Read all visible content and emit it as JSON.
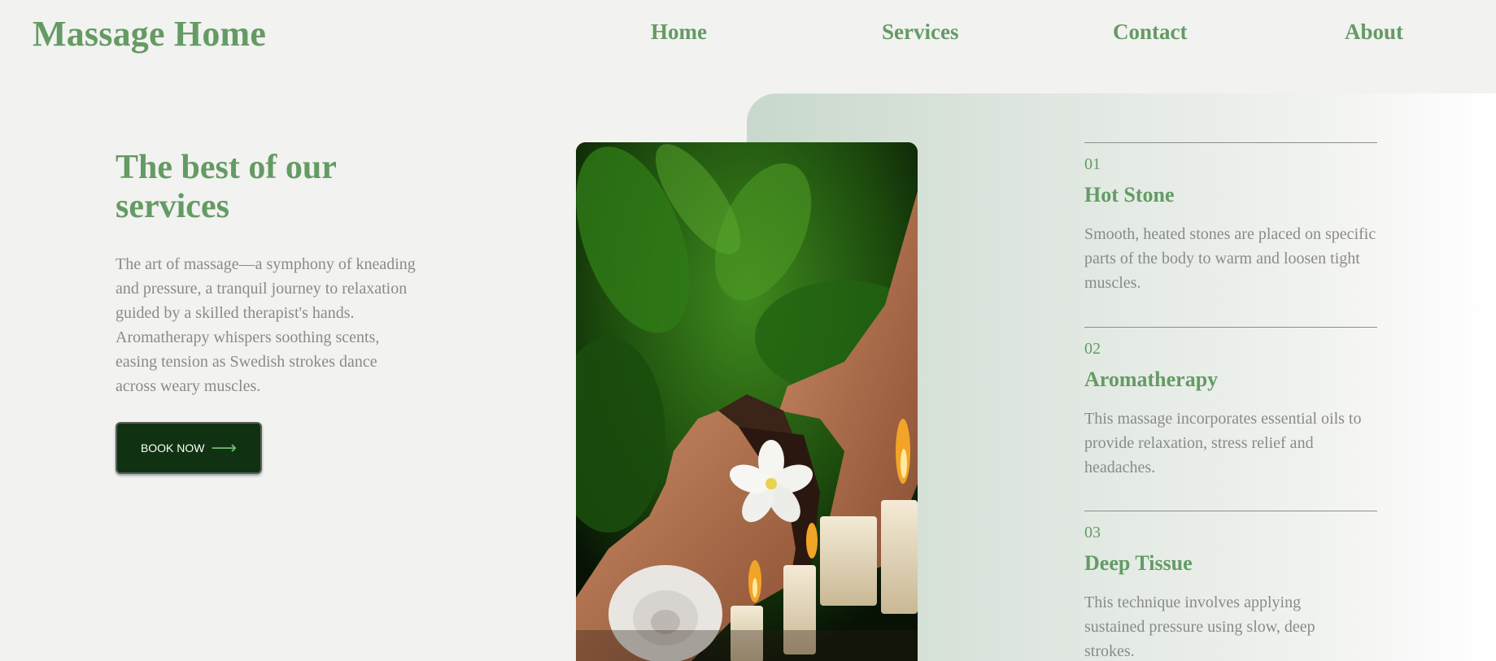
{
  "brand": {
    "name": "Massage Home"
  },
  "nav": {
    "items": [
      "Home",
      "Services",
      "Contact",
      "About"
    ]
  },
  "intro": {
    "heading": "The best of our services",
    "body": "The art of massage—a symphony of kneading and pressure, a tranquil journey to relaxation guided by a skilled therapist's hands. Aromatherapy whispers soothing scents, easing tension as Swedish strokes dance across weary muscles.",
    "cta_label": "BOOK NOW",
    "cta_icon": "arrow-right-icon"
  },
  "services": [
    {
      "number": "01",
      "title": "Hot Stone",
      "description": "Smooth, heated stones are placed on specific parts of the body to warm and loosen tight muscles."
    },
    {
      "number": "02",
      "title": "Aromatherapy",
      "description": "This massage incorporates essential oils to provide relaxation, stress relief and headaches."
    },
    {
      "number": "03",
      "title": "Deep Tissue",
      "description": "This technique involves applying sustained pressure using slow, deep strokes."
    }
  ],
  "colors": {
    "accent": "#649b64",
    "button_bg": "#103212",
    "body_text": "#8a8a8a",
    "page_bg": "#f2f2f0"
  }
}
